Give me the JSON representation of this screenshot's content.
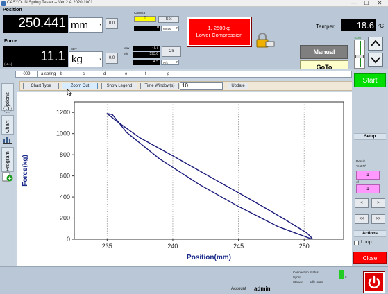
{
  "window": {
    "title": "CASYOUN Spring Tester -- Ver 2.A.2020.1001",
    "minimize": "—",
    "maximize": "☐",
    "close": "✕"
  },
  "position": {
    "label": "Position",
    "value": "250.441",
    "unit": "mm",
    "zero_btn": "0.0"
  },
  "camera": {
    "label": "Camera",
    "value": "0",
    "set_btn": "Set",
    "sub_value": "0",
    "sub_unit": "mm/s"
  },
  "force": {
    "label": "Force",
    "value": "11.1",
    "unit": "kg",
    "zero_btn": "0.0",
    "small_label": "SET",
    "sub_left": "(11.1)",
    "max_label": "Max",
    "max_value": "-7.7",
    "min_label": "Min",
    "min_value": "593.6",
    "rate_value": "4.5",
    "rate_unit": "N/s",
    "clr_btn": "Clr"
  },
  "alarm": {
    "line1": "1. 2500kg",
    "line2": "Lower Compression"
  },
  "temper": {
    "label": "Temper.",
    "value": "18.6",
    "unit": "°C"
  },
  "speed_slider": {
    "top": "100%",
    "bottom": "0%",
    "level": 0.4
  },
  "mode": {
    "manual": "Manual",
    "goto": "GoTo"
  },
  "tabs_row": {
    "id": "009",
    "cols": [
      "a spring",
      "b",
      "c",
      "d",
      "e",
      "f",
      "g"
    ]
  },
  "left_tabs": {
    "options": "Options",
    "chart": "Chart",
    "program": "Program"
  },
  "toolbar": {
    "chart_type": "Chart Type",
    "zoom_out": "Zoom Out",
    "show_legend": "Show Legend",
    "time_window_label": "Time Window(s)",
    "time_window_value": "10",
    "update": "Update"
  },
  "chart_data": {
    "type": "line",
    "xlabel": "Position(mm)",
    "ylabel": "Force(kg)",
    "xlim": [
      232.5,
      253
    ],
    "ylim": [
      0,
      1300
    ],
    "xticks": [
      235,
      240,
      245,
      250
    ],
    "yticks": [
      0,
      200,
      400,
      600,
      800,
      1000,
      1200
    ],
    "grid": "vertical dotted",
    "series": [
      {
        "color": "#1a1a7a",
        "x": [
          250.5,
          248.0,
          245.0,
          242.0,
          239.0,
          236.5,
          235.4,
          235.0,
          235.7,
          237.5,
          240.0,
          243.0,
          246.0,
          248.5,
          250.2,
          250.6
        ],
        "y": [
          5,
          120,
          310,
          520,
          760,
          1010,
          1180,
          1190,
          1120,
          960,
          790,
          580,
          370,
          190,
          60,
          10
        ]
      }
    ]
  },
  "right": {
    "start": "Start",
    "setup": "Setup",
    "result_label": "Result",
    "test_n_label": "Test N°",
    "test_n_value": "1",
    "of_label": "of",
    "of_value": "1",
    "prev": "<",
    "next": ">",
    "first": "<<",
    "last": ">>",
    "actions": "Actions",
    "loop": "Loop",
    "close": "Close"
  },
  "bottom": {
    "account_label": "Account",
    "account_value": "admin",
    "conn_label": "Connection Status:",
    "sync_label": "Sync:",
    "status_label": "Status:",
    "status_value": "Idle State",
    "sync_value": "0"
  }
}
